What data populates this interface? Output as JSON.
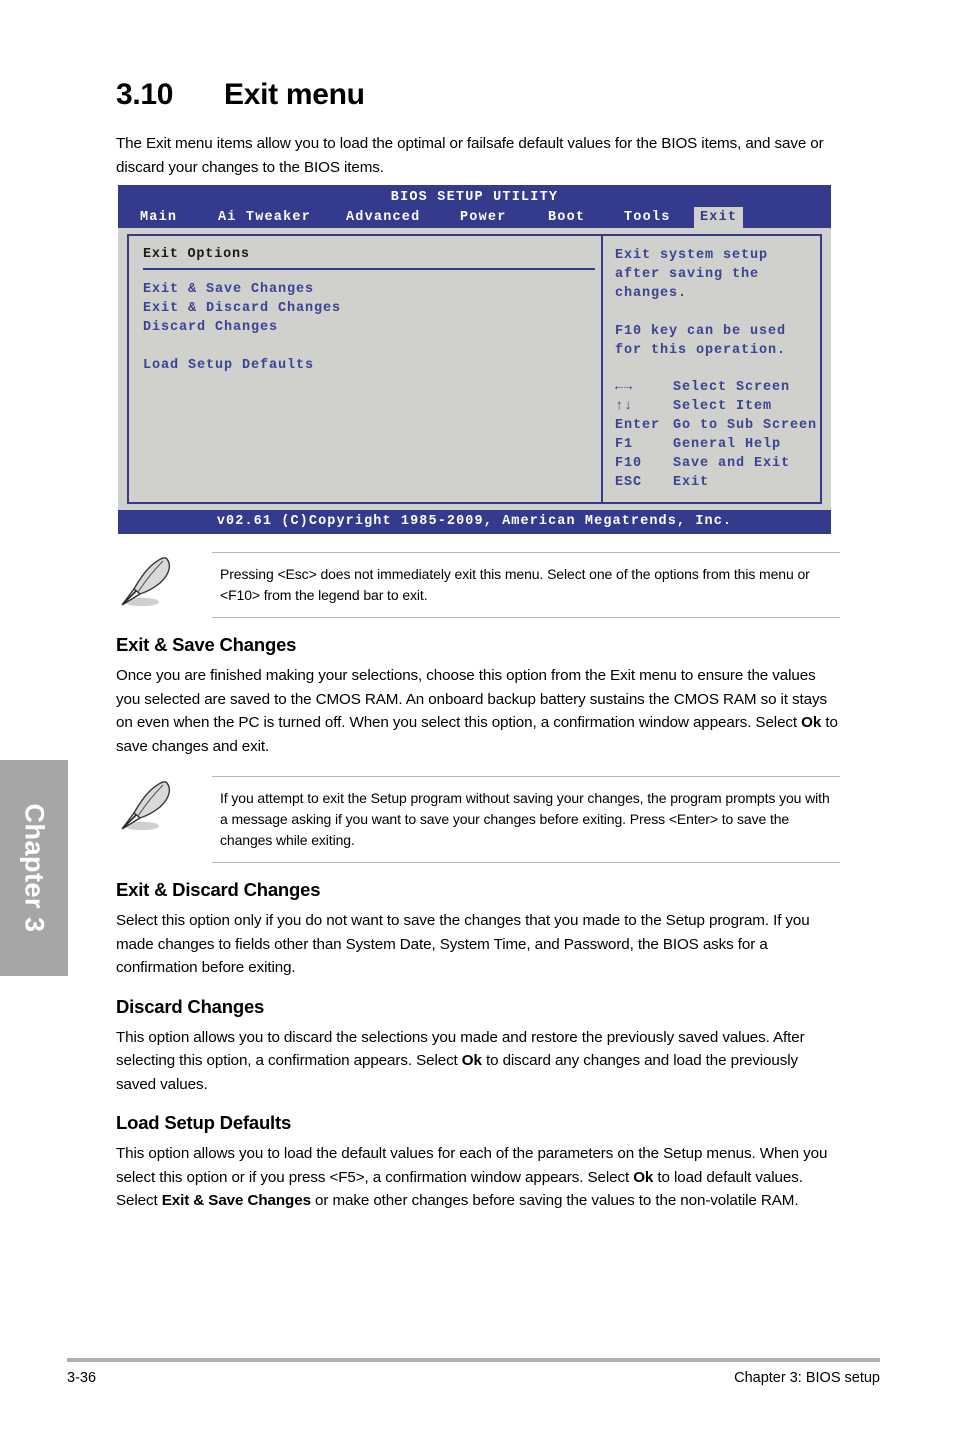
{
  "sidebar": {
    "chapter_tab_label": "Chapter 3"
  },
  "heading": {
    "number": "3.10",
    "title": "Exit menu"
  },
  "intro": "The Exit menu items allow you to load the optimal or failsafe default values for the BIOS items, and save or discard your changes to the BIOS items.",
  "bios": {
    "title": "BIOS SETUP UTILITY",
    "tabs": [
      {
        "label": "Main",
        "active": false
      },
      {
        "label": "Ai Tweaker",
        "active": false
      },
      {
        "label": "Advanced",
        "active": false
      },
      {
        "label": "Power",
        "active": false
      },
      {
        "label": "Boot",
        "active": false
      },
      {
        "label": "Tools",
        "active": false
      },
      {
        "label": "Exit",
        "active": true
      }
    ],
    "section_title": "Exit Options",
    "items": [
      "Exit & Save Changes",
      "Exit & Discard Changes",
      "Discard Changes",
      "Load Setup Defaults"
    ],
    "help_lines_1": [
      "Exit system setup",
      "after saving the",
      "changes."
    ],
    "help_lines_2": [
      "F10 key can be used",
      "for this operation."
    ],
    "legend": [
      {
        "key": "←→",
        "desc": "Select Screen"
      },
      {
        "key": "↑↓",
        "desc": "Select Item"
      },
      {
        "key": "Enter",
        "desc": "Go to Sub Screen"
      },
      {
        "key": "F1",
        "desc": "General Help"
      },
      {
        "key": "F10",
        "desc": "Save and Exit"
      },
      {
        "key": "ESC",
        "desc": "Exit"
      }
    ],
    "footer": "v02.61 (C)Copyright 1985-2009, American Megatrends, Inc.",
    "colors": {
      "bar": "#343a8c",
      "panel": "#d0d0cc",
      "text": "#3b4395"
    }
  },
  "note1": {
    "icon": "quill-pen-icon",
    "text": "Pressing <Esc> does not immediately exit this menu. Select one of the options from this menu or <F10> from the legend bar to exit."
  },
  "note2": {
    "icon": "quill-pen-icon",
    "text": "If you attempt to exit the Setup program without saving your changes, the program prompts you with a message asking if you want to save your changes before exiting. Press <Enter> to save the changes while exiting."
  },
  "sections": {
    "exit_save": {
      "heading": "Exit & Save Changes",
      "para_part1": "Once you are finished making your selections, choose this option from the Exit menu to ensure the values you selected are saved to the CMOS RAM. An onboard backup battery sustains the CMOS RAM so it stays on even when the PC is turned off. When you select this option, a confirmation window appears. Select ",
      "para_bold1": "Ok",
      "para_part2": " to save changes and exit."
    },
    "exit_discard": {
      "heading": "Exit & Discard Changes",
      "para": "Select this option only if you do not want to save the changes that you  made to the Setup program. If you made changes to fields other than System Date, System Time, and Password, the BIOS asks for a confirmation before exiting."
    },
    "discard": {
      "heading": "Discard Changes",
      "para_part1": "This option allows you to discard the selections you made and restore the previously saved values. After selecting this option, a confirmation appears. Select ",
      "para_bold1": "Ok",
      "para_part2": " to discard any changes and load the previously saved values."
    },
    "load_defaults": {
      "heading": "Load Setup Defaults",
      "para_part1": "This option allows you to load the default values for each of the parameters on the Setup menus. When you select this option or if you press <F5>, a confirmation window appears. Select ",
      "para_bold1": "Ok",
      "para_part2": " to load default values. Select ",
      "para_bold2": "Exit & Save Changes",
      "para_part3": " or make other changes before saving the values to the non-volatile RAM."
    }
  },
  "footer": {
    "page_number": "3-36",
    "chapter_label": "Chapter 3: BIOS setup"
  }
}
